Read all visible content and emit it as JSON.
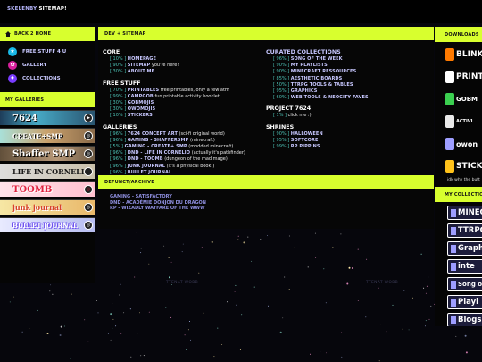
{
  "header": {
    "site_a": "SKELENBY",
    "site_b": "SITEMAP!"
  },
  "left": {
    "back_label": "BACK 2 HOME",
    "nav": [
      {
        "label": "FREE STUFF 4 U",
        "glyph": "★"
      },
      {
        "label": "GALLERY",
        "glyph": "✿"
      },
      {
        "label": "COLLECTIONS",
        "glyph": "♦"
      }
    ],
    "galleries_title": "MY GALLERIES",
    "galleries": [
      {
        "label": "7624",
        "badge": "▶"
      },
      {
        "label": "CREATE+SMP",
        "badge": "◎"
      },
      {
        "label": "Shaffer SMP",
        "badge": "◎"
      },
      {
        "label": "LIFE IN CORNELIO",
        "badge": "◎"
      },
      {
        "label": "TOOMB",
        "badge": "◎"
      },
      {
        "label": "junk journal",
        "badge": "◎"
      },
      {
        "label": "BULLET JOURNAL",
        "badge": "◎"
      }
    ]
  },
  "sitemap": {
    "title": "DEV + SITEMAP",
    "left_sections": [
      {
        "heading": "CORE",
        "current": false,
        "items": [
          {
            "pct": "[ 10% ]",
            "link": "HOMEPAGE",
            "desc": ""
          },
          {
            "pct": "[ 90% ]",
            "link": "SITEMAP",
            "desc": "you're here!"
          },
          {
            "pct": "[ 30% ]",
            "link": "ABOUT ME",
            "desc": ""
          }
        ]
      },
      {
        "heading": "FREE STUFF",
        "current": false,
        "items": [
          {
            "pct": "[ 70% ]",
            "link": "PRINTABLES",
            "desc": "free printables, only a few atm"
          },
          {
            "pct": "[ 99% ]",
            "link": "CAMPGOB",
            "desc": "fun printable activity booklet"
          },
          {
            "pct": "[ 30% ]",
            "link": "GOBMOJIS",
            "desc": ""
          },
          {
            "pct": "[ 30% ]",
            "link": "OWOMOJIS",
            "desc": ""
          },
          {
            "pct": "[ 10% ]",
            "link": "STICKERS",
            "desc": ""
          }
        ]
      },
      {
        "heading": "GALLERIES",
        "current": false,
        "items": [
          {
            "pct": "[ 96% ]",
            "link": "7624 CONCEPT ART",
            "desc": "(sci-fi original world)"
          },
          {
            "pct": "[ 96% ]",
            "link": "GAMING - SHAFFERSMP",
            "desc": "(minecraft)"
          },
          {
            "pct": "[ 5% ]",
            "link": "GAMING - CREATE+ SMP",
            "desc": "(modded minecraft)"
          },
          {
            "pct": "[ 96% ]",
            "link": "DND - LIFE IN CORNELIO",
            "desc": "(actually it's pathfinder)"
          },
          {
            "pct": "[ 96% ]",
            "link": "DND - TOOMB",
            "desc": "(dungeon of the mad mage)"
          },
          {
            "pct": "[ 96% ]",
            "link": "JUNK JOURNAL",
            "desc": "(it's a physical book!)"
          },
          {
            "pct": "[ 96% ]",
            "link": "BULLET JOURNAL",
            "desc": ""
          }
        ]
      }
    ],
    "right_sections": [
      {
        "heading": "CURATED COLLECTIONS",
        "current": true,
        "items": [
          {
            "pct": "[ 96% ]",
            "link": "SONG OF THE WEEK",
            "desc": ""
          },
          {
            "pct": "[ 90% ]",
            "link": "MY PLAYLISTS",
            "desc": ""
          },
          {
            "pct": "[ 90% ]",
            "link": "MINECRAFT RESSOURCES",
            "desc": ""
          },
          {
            "pct": "[ 85% ]",
            "link": "AESTHETIC BOARDS",
            "desc": ""
          },
          {
            "pct": "[ 50% ]",
            "link": "TTRPG TOOLS & TABLES",
            "desc": ""
          },
          {
            "pct": "[ 95% ]",
            "link": "GRAPHICS",
            "desc": ""
          },
          {
            "pct": "[ 60% ]",
            "link": "WEB TOOLS & NEOCITY FAVES",
            "desc": ""
          }
        ]
      },
      {
        "heading": "PROJECT 7624",
        "current": false,
        "items": [
          {
            "pct": "[ 1% ]",
            "link": "",
            "desc": "click me :)"
          }
        ]
      },
      {
        "heading": "SHRINES",
        "current": false,
        "items": [
          {
            "pct": "[ 90% ]",
            "link": "HALLOWEEN",
            "desc": ""
          },
          {
            "pct": "[ 95% ]",
            "link": "SOFTCORE",
            "desc": ""
          },
          {
            "pct": "[ 99% ]",
            "link": "RP PIPPINS",
            "desc": ""
          }
        ]
      }
    ]
  },
  "archive": {
    "title": "DEFUNCT/ARCHIVE",
    "items": [
      "GAMING - SATISFACTORY",
      "DND - ACADÉMIE DONJON DU DRAGON",
      "RP - WIZADLY WAYFARE OF THE WWW"
    ]
  },
  "right": {
    "downloads_title": "DOWNLOADS",
    "downloads": [
      "BLINK",
      "PRINTA",
      "GOBM",
      "ACTIVI",
      "owon",
      "STICK"
    ],
    "downloads_note": "idk why the butt",
    "collections_title": "MY COLLECTIONS",
    "collections": [
      "MINECRAF",
      "TTRPG",
      "Graph",
      "inte",
      "Song of t",
      "Playl",
      "Blogs &"
    ]
  },
  "watermark": "TTENAT WOBB",
  "colors": {
    "lime": "#d8ff2e",
    "link": "#c8c8ff",
    "pct": "#4cc1b5"
  }
}
